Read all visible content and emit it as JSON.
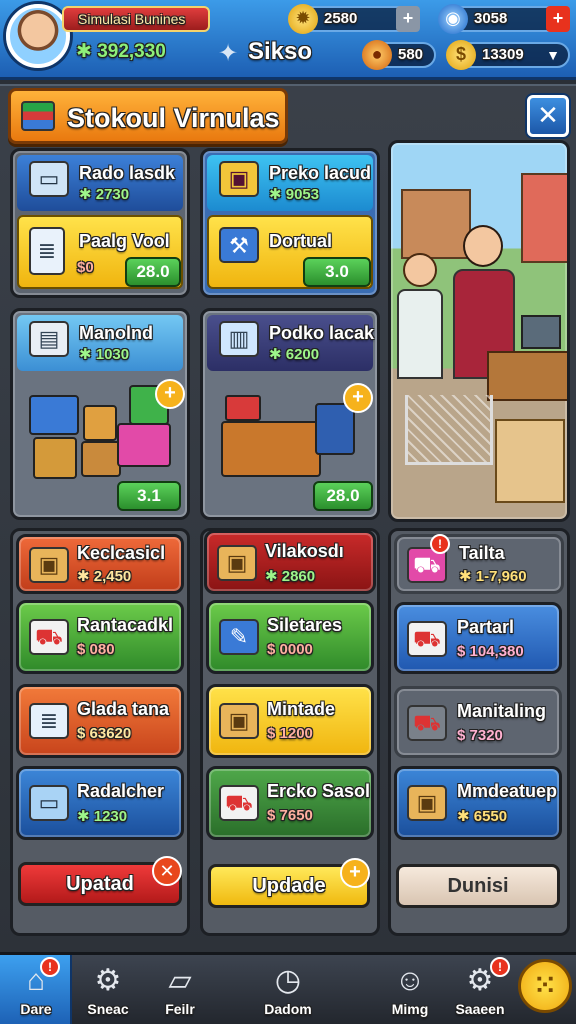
{
  "top_bar": {
    "business_name": "Simulasi Bunines",
    "money": "✱ 392,330",
    "level_label": "Sikso",
    "coins": "2580",
    "gems": "3058",
    "currency_a": "580",
    "currency_b": "13309"
  },
  "panel": {
    "title": "Stokoul Virnulas",
    "close_label": "✕"
  },
  "top_cards": [
    {
      "label": "Rado lasdk",
      "value": "✱ 2730",
      "sub_label": "Paalg Vool",
      "sub_value": "$0",
      "price": "28.0"
    },
    {
      "label": "Preko lacud",
      "value": "✱ 9053",
      "sub_label": "Dortual",
      "price": "3.0"
    },
    {
      "label": "Manolnd",
      "value": "✱ 1030",
      "price": "3.1"
    },
    {
      "label": "Podko lacak",
      "value": "✱ 6200",
      "price": "28.0"
    }
  ],
  "columns": {
    "left": {
      "items": [
        {
          "label": "Keclcasicl",
          "value": "✱ 2,450"
        },
        {
          "label": "Rantacadkl",
          "value": "$ 080"
        },
        {
          "label": "Glada tana",
          "value": "$ 63620"
        },
        {
          "label": "Radalcher",
          "value": "✱ 1230"
        }
      ],
      "button": "Upatad"
    },
    "middle": {
      "items": [
        {
          "label": "Vilakosdı",
          "value": "✱ 2860"
        },
        {
          "label": "Siletares",
          "value": "$ 0000"
        },
        {
          "label": "Mintade",
          "value": "$ 1200"
        },
        {
          "label": "Ercko Sasol",
          "value": "$ 7650"
        }
      ],
      "button": "Updade"
    },
    "right": {
      "items": [
        {
          "label": "Tailta",
          "value": "✱ 1-7,960"
        },
        {
          "label": "Partarl",
          "value": "$ 104,380"
        },
        {
          "label": "Manitaling",
          "value": "$ 7320"
        },
        {
          "label": "Mmdeatuep",
          "value": "✱ 6550"
        }
      ],
      "button": "Dunisi"
    }
  },
  "nav": [
    {
      "label": "Dare",
      "badge": "!"
    },
    {
      "label": "Sneac"
    },
    {
      "label": "Feilr"
    },
    {
      "label": "Dadom"
    },
    {
      "label": "Mimg"
    },
    {
      "label": "Saaeen",
      "badge": "!"
    }
  ],
  "colors": {
    "top_bar": "#2a7fd4",
    "title_orange": "#f39a22",
    "price_green": "#3aa83b",
    "update_red": "#d62b2b",
    "update_yellow": "#f2c91a"
  }
}
